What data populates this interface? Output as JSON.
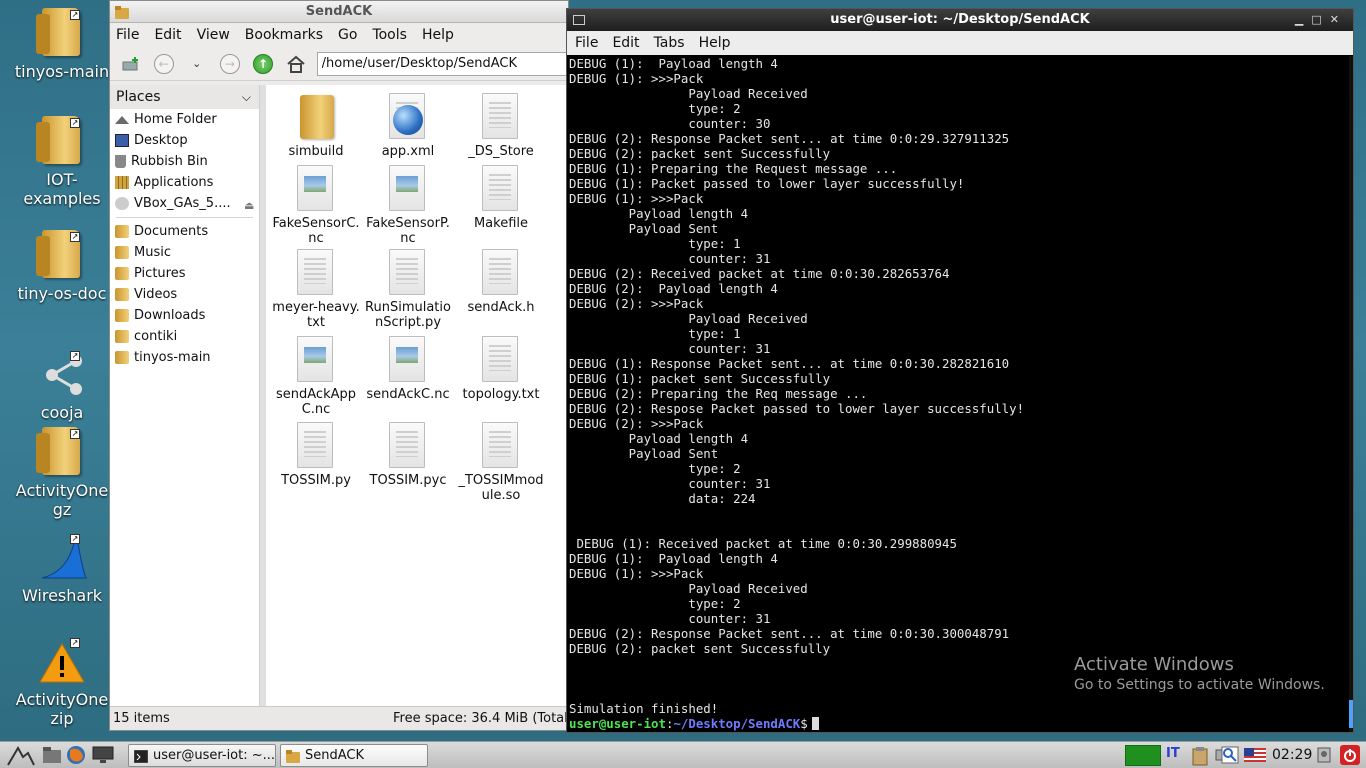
{
  "desktop": {
    "icons": [
      {
        "label": "tinyos-main",
        "kind": "folder"
      },
      {
        "label": "IOT-examples",
        "kind": "folder"
      },
      {
        "label": "tiny-os-doc",
        "kind": "folder"
      },
      {
        "label": "cooja",
        "kind": "share"
      },
      {
        "label": "ActivityOne gz",
        "kind": "folder"
      },
      {
        "label": "Wireshark",
        "kind": "wireshark"
      },
      {
        "label": "ActivityOne zip",
        "kind": "warning"
      }
    ]
  },
  "file_manager": {
    "title": "SendACK",
    "menu": [
      "File",
      "Edit",
      "View",
      "Bookmarks",
      "Go",
      "Tools",
      "Help"
    ],
    "path": "/home/user/Desktop/SendACK",
    "places_header": "Places",
    "places": [
      {
        "label": "Home Folder",
        "icon": "home-icon"
      },
      {
        "label": "Desktop",
        "icon": "desktop-icon"
      },
      {
        "label": "Rubbish Bin",
        "icon": "trash-icon"
      },
      {
        "label": "Applications",
        "icon": "applications-icon"
      },
      {
        "label": "VBox_GAs_5....",
        "icon": "disc-icon"
      }
    ],
    "bookmarks": [
      "Documents",
      "Music",
      "Pictures",
      "Videos",
      "Downloads",
      "contiki",
      "tinyos-main"
    ],
    "files": [
      {
        "name": "simbuild",
        "type": "folder"
      },
      {
        "name": "app.xml",
        "type": "xml"
      },
      {
        "name": "_DS_Store",
        "type": "text"
      },
      {
        "name": "FakeSensorC.nc",
        "type": "image"
      },
      {
        "name": "FakeSensorP.nc",
        "type": "image"
      },
      {
        "name": "Makefile",
        "type": "text"
      },
      {
        "name": "meyer-heavy.txt",
        "type": "text"
      },
      {
        "name": "RunSimulationScript.py",
        "type": "text"
      },
      {
        "name": "sendAck.h",
        "type": "text"
      },
      {
        "name": "sendAckAppC.nc",
        "type": "image"
      },
      {
        "name": "sendAckC.nc",
        "type": "image"
      },
      {
        "name": "topology.txt",
        "type": "text"
      },
      {
        "name": "TOSSIM.py",
        "type": "text"
      },
      {
        "name": "TOSSIM.pyc",
        "type": "text"
      },
      {
        "name": "_TOSSIMmodule.so",
        "type": "text"
      }
    ],
    "status_items": "15 items",
    "status_free": "Free space: 36.4 MiB (Total"
  },
  "terminal": {
    "title": "user@user-iot: ~/Desktop/SendACK",
    "menu": [
      "File",
      "Edit",
      "Tabs",
      "Help"
    ],
    "lines": [
      "DEBUG (1):  Payload length 4",
      "DEBUG (1): >>>Pack",
      "                Payload Received",
      "                type: 2",
      "                counter: 30",
      "DEBUG (2): Response Packet sent... at time 0:0:29.327911325",
      "DEBUG (2): packet sent Successfully",
      "DEBUG (1): Preparing the Request message ...",
      "DEBUG (1): Packet passed to lower layer successfully!",
      "DEBUG (1): >>>Pack",
      "        Payload length 4",
      "        Payload Sent",
      "                type: 1",
      "                counter: 31",
      "DEBUG (2): Received packet at time 0:0:30.282653764",
      "DEBUG (2):  Payload length 4",
      "DEBUG (2): >>>Pack",
      "                Payload Received",
      "                type: 1",
      "                counter: 31",
      "DEBUG (1): Response Packet sent... at time 0:0:30.282821610",
      "DEBUG (1): packet sent Successfully",
      "DEBUG (2): Preparing the Req message ...",
      "DEBUG (2): Respose Packet passed to lower layer successfully!",
      "DEBUG (2): >>>Pack",
      "        Payload length 4",
      "        Payload Sent",
      "                type: 2",
      "                counter: 31",
      "                data: 224",
      "",
      "",
      " DEBUG (1): Received packet at time 0:0:30.299880945",
      "DEBUG (1):  Payload length 4",
      "DEBUG (1): >>>Pack",
      "                Payload Received",
      "                type: 2",
      "                counter: 31",
      "DEBUG (2): Response Packet sent... at time 0:0:30.300048791",
      "DEBUG (2): packet sent Successfully",
      "",
      "",
      "",
      "Simulation finished!"
    ],
    "prompt_user": "user@user-iot",
    "prompt_sep": ":",
    "prompt_path": "~/Desktop/SendACK",
    "prompt_symbol": "$"
  },
  "watermark": {
    "title": "Activate Windows",
    "subtitle": "Go to Settings to activate Windows."
  },
  "taskbar": {
    "tasks": [
      {
        "label": "user@user-iot: ~...",
        "icon": "terminal-icon"
      },
      {
        "label": "SendACK",
        "icon": "folder-icon"
      }
    ],
    "clock": "02:29",
    "keyboard_layout": "IT"
  }
}
